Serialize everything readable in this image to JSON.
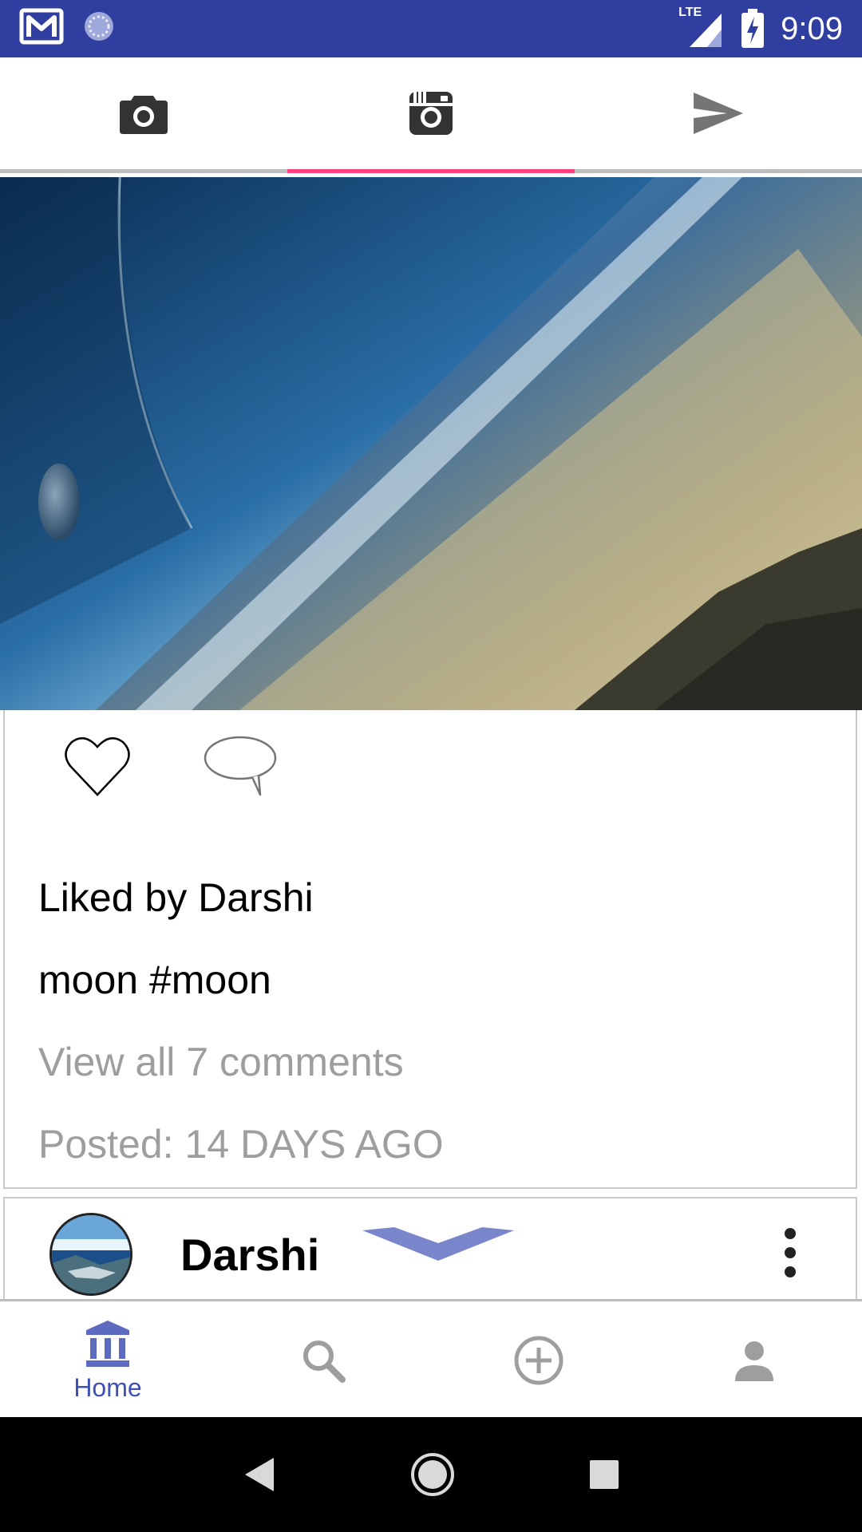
{
  "status_bar": {
    "time": "9:09",
    "network": "LTE",
    "icons": [
      "gmail-icon",
      "sync-icon",
      "signal-icon",
      "battery-charging-icon"
    ]
  },
  "top_tabs": [
    {
      "icon": "camera-icon",
      "active": false
    },
    {
      "icon": "instagram-icon",
      "active": true
    },
    {
      "icon": "send-icon",
      "active": false
    }
  ],
  "post": {
    "image_alt": "planet horizon",
    "liked_by": "Liked by Darshi",
    "caption": "moon #moon",
    "comments_link": "View all 7 comments",
    "posted": "Posted: 14 DAYS AGO"
  },
  "next_post": {
    "username": "Darshi"
  },
  "bottom_nav": {
    "items": [
      {
        "icon": "home-icon",
        "label": "Home",
        "active": true
      },
      {
        "icon": "search-icon",
        "label": "",
        "active": false
      },
      {
        "icon": "add-circle-icon",
        "label": "",
        "active": false
      },
      {
        "icon": "profile-icon",
        "label": "",
        "active": false
      }
    ]
  },
  "colors": {
    "status_bar": "#303F9F",
    "accent": "#FF4081",
    "primary": "#3F51B5"
  }
}
